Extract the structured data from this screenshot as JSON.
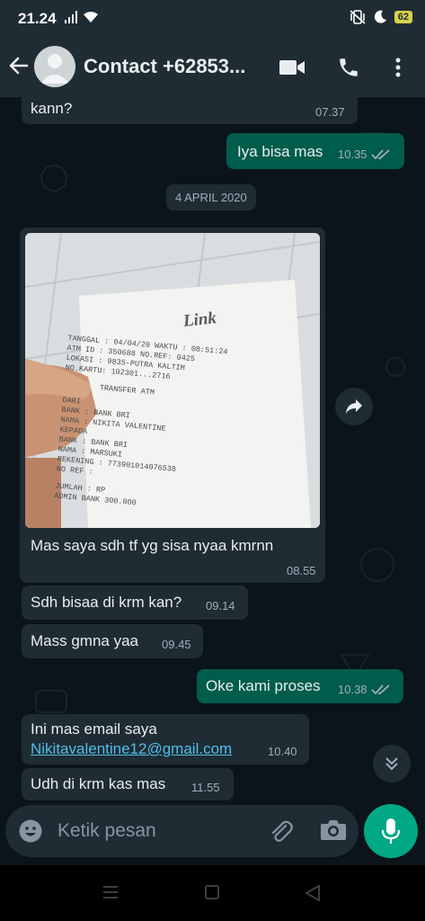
{
  "status_bar": {
    "time": "21.24",
    "battery": "62"
  },
  "header": {
    "contact_name": "Contact +62853..."
  },
  "date_separator": "4 APRIL 2020",
  "messages": [
    {
      "direction": "in",
      "text": "kann?",
      "time": "07.37"
    },
    {
      "direction": "out",
      "text": "Iya bisa mas",
      "time": "10.35"
    },
    {
      "direction": "in",
      "text": "Mas saya sdh tf yg sisa nyaa kmrnn",
      "time": "08.55",
      "image": "atm-transfer-receipt"
    },
    {
      "direction": "in",
      "text": "Sdh bisaa di krm kan?",
      "time": "09.14"
    },
    {
      "direction": "in",
      "text": "Mass gmna yaa",
      "time": "09.45"
    },
    {
      "direction": "out",
      "text": "Oke kami proses",
      "time": "10.38"
    },
    {
      "direction": "in",
      "text": "Ini mas email saya",
      "link": "Nikitavalentine12@gmail.com",
      "time": "10.40"
    },
    {
      "direction": "in",
      "text": "Udh di krm kas mas",
      "time": "11.55"
    }
  ],
  "receipt_photo": {
    "logo": "Link",
    "lines": [
      "TANGGAL : 04/04/20   WAKTU : 08:51:24",
      "ATM ID : 350688     NO.REF: 0425",
      "LOKASI : 9835-PUTRA KALTIM",
      "NO.KARTU: 102301...2716",
      "TRANSFER ATM",
      "DARI",
      "BANK     : BANK BRI",
      "NAMA     : NIKITA VALENTINE",
      "KEPADA",
      "BANK     : BANK BRI",
      "NAMA     : MARSUKI",
      "REKENING : 773901014076538",
      "NO REF   :",
      "JUMLAH   : RP",
      "ADMIN BANK        300.000"
    ]
  },
  "input": {
    "placeholder": "Ketik pesan"
  },
  "colors": {
    "header": "#1f2c33",
    "chat_bg": "#0b141a",
    "incoming": "#1f2c33",
    "outgoing": "#005c4b",
    "accent": "#00a884",
    "link": "#53bdeb",
    "read_ticks": "#53bdeb"
  }
}
